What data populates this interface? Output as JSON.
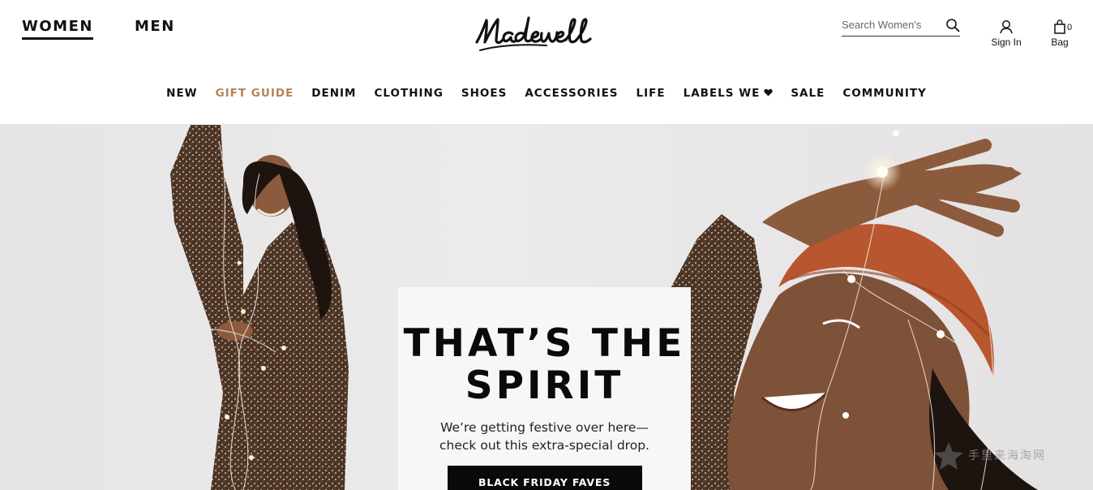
{
  "header": {
    "departments": [
      {
        "label": "WOMEN",
        "active": true
      },
      {
        "label": "MEN",
        "active": false
      }
    ],
    "logo_text": "Madewell",
    "search": {
      "placeholder": "Search Women's",
      "icon": "search-icon"
    },
    "account": {
      "label": "Sign In",
      "icon": "user-icon"
    },
    "bag": {
      "label": "Bag",
      "count": "0",
      "icon": "shopping-bag-icon"
    }
  },
  "nav": {
    "items": [
      "NEW",
      "GIFT GUIDE",
      "DENIM",
      "CLOTHING",
      "SHOES",
      "ACCESSORIES",
      "LIFE",
      "LABELS WE",
      "SALE",
      "COMMUNITY"
    ],
    "highlight_color": "#b58356",
    "labels_we_icon": "heart-icon"
  },
  "hero": {
    "headline_line1": "THAT’S THE",
    "headline_line2": "SPIRIT",
    "body_line1": "We’re getting festive over here—",
    "body_line2": "check out this extra-special drop.",
    "cta": "BLACK FRIDAY FAVES"
  },
  "watermark": {
    "text": "手里来海淘网"
  }
}
